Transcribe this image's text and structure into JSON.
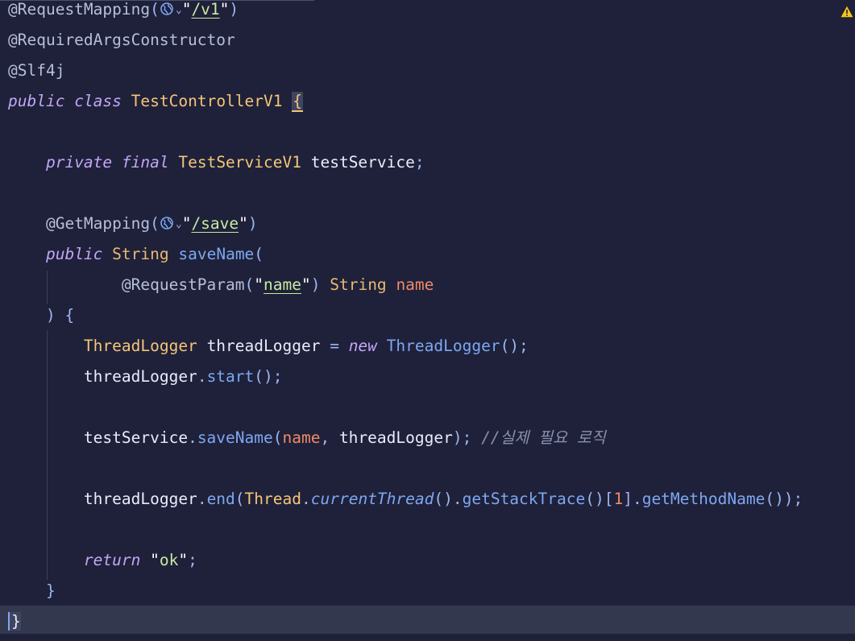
{
  "code": {
    "line1": {
      "annotation": "@RequestMapping",
      "path": "/v1"
    },
    "line2": {
      "annotation": "@RequiredArgsConstructor"
    },
    "line3": {
      "annotation": "@Slf4j"
    },
    "line4": {
      "kw_public": "public",
      "kw_class": "class",
      "class_name": "TestControllerV1",
      "brace": "{"
    },
    "line6": {
      "kw_private": "private",
      "kw_final": "final",
      "type": "TestServiceV1",
      "field": "testService",
      "semi": ";"
    },
    "line8": {
      "annotation": "@GetMapping",
      "path": "/save"
    },
    "line9": {
      "kw_public": "public",
      "type": "String",
      "method": "saveName",
      "paren": "("
    },
    "line10": {
      "annotation": "@RequestParam",
      "param_key": "name",
      "type": "String",
      "param": "name"
    },
    "line11": {
      "text": ") {"
    },
    "line12": {
      "type": "ThreadLogger",
      "var": "threadLogger",
      "eq": " = ",
      "kw_new": "new",
      "ctor": "ThreadLogger",
      "tail": "();"
    },
    "line13": {
      "var": "threadLogger",
      "method": "start",
      "tail": "();"
    },
    "line15": {
      "var": "testService",
      "method": "saveName",
      "arg1": "name",
      "arg2": "threadLogger",
      "comment": "//실제 필요 로직"
    },
    "line17": {
      "var": "threadLogger",
      "method": "end",
      "thread": "Thread",
      "current": "currentThread",
      "stack": "getStackTrace",
      "index": "1",
      "getname": "getMethodName"
    },
    "line19": {
      "kw_return": "return",
      "value": "ok"
    },
    "line20": {
      "text": "}"
    },
    "line21": {
      "text": "}"
    }
  },
  "icons": {
    "globe": "globe-icon",
    "dropdown": "chevron-down-icon",
    "warning": "warning-icon"
  },
  "colors": {
    "background": "#1e2139",
    "keyword": "#c4a5f7",
    "class": "#f5c578",
    "function": "#7ea7f2",
    "string": "#c9e8a4",
    "parameter": "#f08a6a",
    "warning": "#f5c518"
  }
}
